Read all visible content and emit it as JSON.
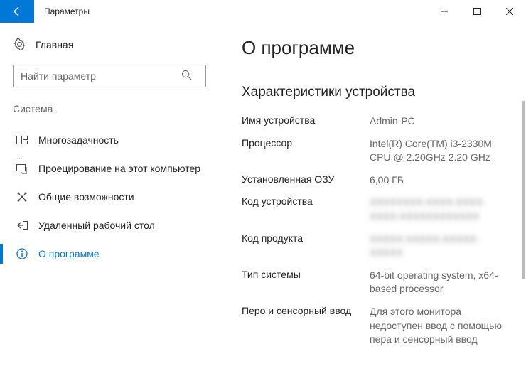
{
  "window": {
    "title": "Параметры"
  },
  "sidebar": {
    "home_label": "Главная",
    "search_placeholder": "Найти параметр",
    "group_title": "Система",
    "items": [
      {
        "label": "Многозадачность"
      },
      {
        "label": "Проецирование на этот компьютер"
      },
      {
        "label": "Общие возможности"
      },
      {
        "label": "Удаленный рабочий стол"
      },
      {
        "label": "О программе"
      }
    ]
  },
  "main": {
    "page_title": "О программе",
    "section_title": "Характеристики устройства",
    "specs": {
      "device_name_label": "Имя устройства",
      "device_name_value": "Admin-PC",
      "processor_label": "Процессор",
      "processor_value": "Intel(R) Core(TM) i3-2330M CPU @ 2.20GHz 2.20 GHz",
      "ram_label": "Установленная ОЗУ",
      "ram_value": "6,00 ГБ",
      "device_id_label": "Код устройства",
      "device_id_value": "XXXXXXXX-XXXX-XXXX-XXXX-XXXXXXXXXXXX",
      "product_id_label": "Код продукта",
      "product_id_value": "XXXXX-XXXXX-XXXXX-XXXXX",
      "system_type_label": "Тип системы",
      "system_type_value": "64-bit operating system, x64-based processor",
      "pen_touch_label": "Перо и сенсорный ввод",
      "pen_touch_value": "Для этого монитора недоступен ввод с помощью пера и сенсорный ввод"
    }
  }
}
